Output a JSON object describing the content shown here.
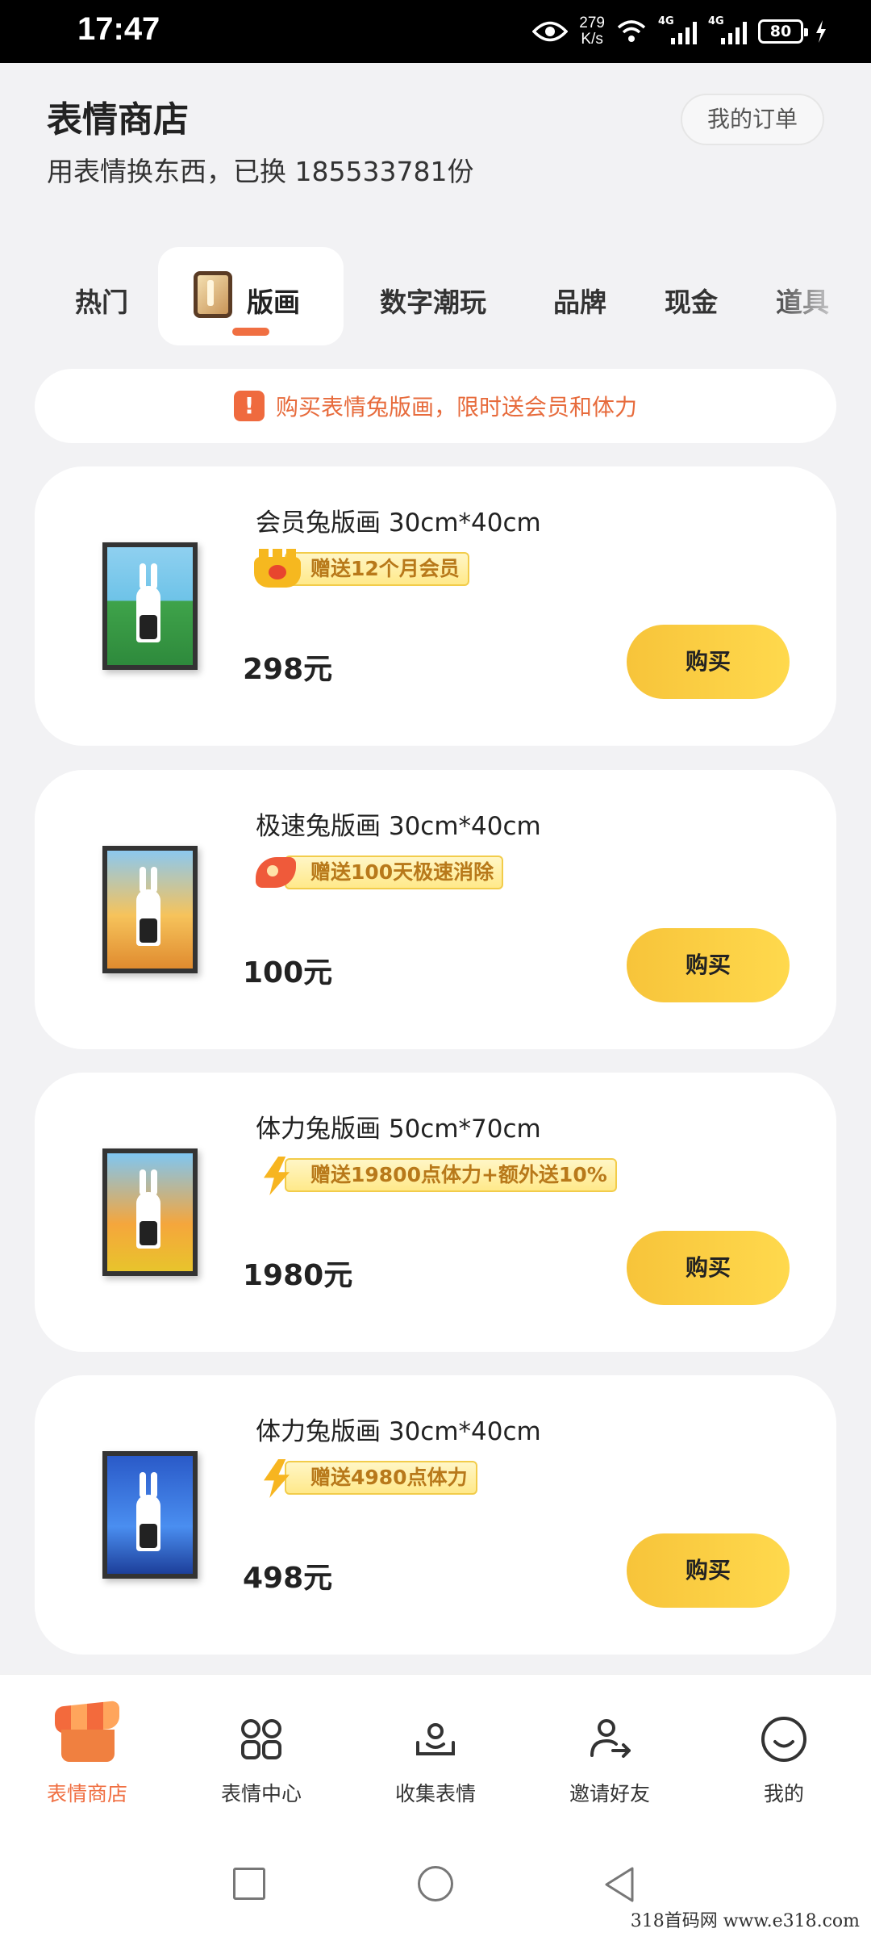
{
  "status_bar": {
    "time": "17:47",
    "speed_value": "279",
    "speed_unit": "K/s",
    "network_1": "4G",
    "network_2": "4G",
    "battery": "80"
  },
  "header": {
    "title": "表情商店",
    "subtitle": "用表情换东西，已换 185533781份",
    "orders_button": "我的订单"
  },
  "tabs": [
    {
      "label": "热门",
      "active": false
    },
    {
      "label": "版画",
      "active": true
    },
    {
      "label": "数字潮玩",
      "active": false
    },
    {
      "label": "品牌",
      "active": false
    },
    {
      "label": "现金",
      "active": false
    },
    {
      "label": "道具",
      "active": false
    }
  ],
  "notice": {
    "icon": "exclamation-icon",
    "text": "购买表情兔版画，限时送会员和体力"
  },
  "products": [
    {
      "name": "会员兔版画 30cm*40cm",
      "gift_icon": "crown-icon",
      "gift": "赠送12个月会员",
      "price": "298元",
      "buy_label": "购买",
      "thumb": "member-rabbit-print"
    },
    {
      "name": "极速兔版画 30cm*40cm",
      "gift_icon": "rocket-icon",
      "gift": "赠送100天极速消除",
      "price": "100元",
      "buy_label": "购买",
      "thumb": "speed-rabbit-print"
    },
    {
      "name": "体力兔版画 50cm*70cm",
      "gift_icon": "lightning-icon",
      "gift": "赠送19800点体力+额外送10%",
      "price": "1980元",
      "buy_label": "购买",
      "thumb": "stamina-rabbit-print-large"
    },
    {
      "name": "体力兔版画 30cm*40cm",
      "gift_icon": "lightning-icon",
      "gift": "赠送4980点体力",
      "price": "498元",
      "buy_label": "购买",
      "thumb": "stamina-rabbit-print"
    }
  ],
  "bottom_nav": [
    {
      "label": "表情商店",
      "icon": "shop-icon",
      "active": true
    },
    {
      "label": "表情中心",
      "icon": "grid-icon",
      "active": false
    },
    {
      "label": "收集表情",
      "icon": "collect-icon",
      "active": false
    },
    {
      "label": "邀请好友",
      "icon": "invite-icon",
      "active": false
    },
    {
      "label": "我的",
      "icon": "smile-icon",
      "active": false
    }
  ],
  "watermark": "318首码网 www.e318.com",
  "colors": {
    "accent": "#f06f42",
    "buy_button": "#f7c43a",
    "background": "#f2f2f4"
  }
}
